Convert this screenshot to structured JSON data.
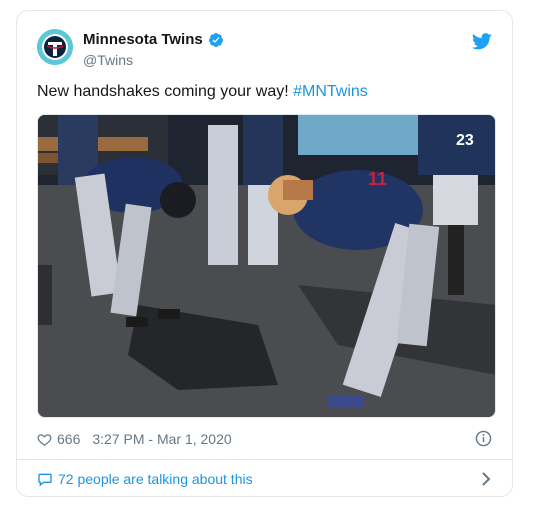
{
  "tweet": {
    "display_name": "Minnesota Twins",
    "handle": "@Twins",
    "text_plain": "New handshakes coming your way! ",
    "hashtag": "#MNTwins",
    "like_count": "666",
    "timestamp": "3:27 PM - Mar 1, 2020",
    "conversation_text": "72 people are talking about this"
  },
  "colors": {
    "link": "#1b95e0",
    "muted": "#657786",
    "avatar_bg": "#5cc7d8",
    "twitter_blue": "#1da1f2"
  },
  "icons": {
    "verified": "verified-badge-icon",
    "brand": "twitter-bird-icon",
    "like": "heart-icon",
    "info": "info-icon",
    "reply": "speech-bubble-icon",
    "more": "chevron-right-icon"
  },
  "image": {
    "alt": "Twins players bending over in the dugout, tapping feet as a new handshake"
  }
}
